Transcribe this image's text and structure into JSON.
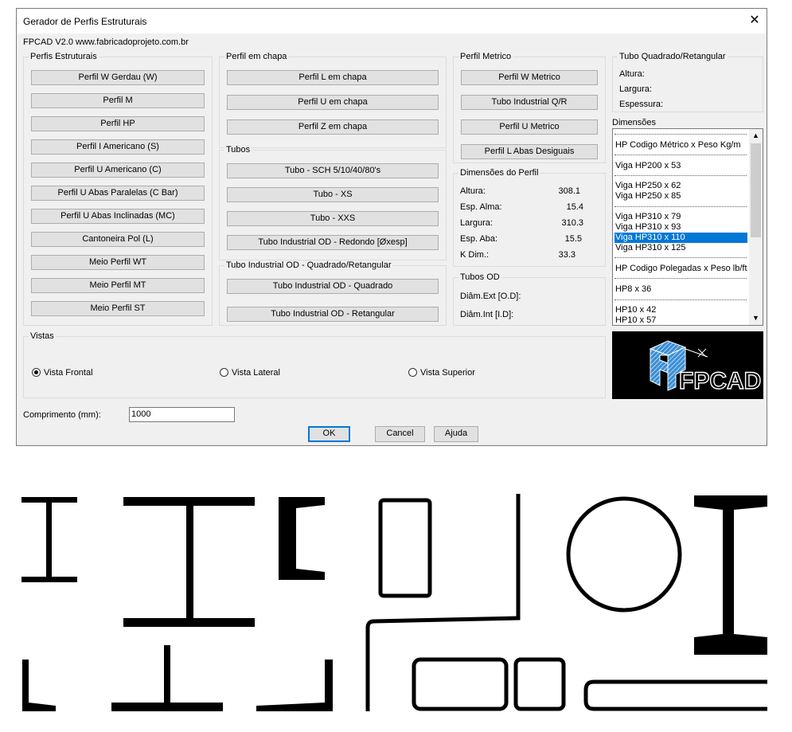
{
  "window": {
    "title": "Gerador de Perfis Estruturais",
    "close_glyph": "✕"
  },
  "header": {
    "version": "FPCAD V2.0 www.fabricadoprojeto.com.br"
  },
  "groups": {
    "perfis_estruturais": {
      "label": "Perfis Estruturais",
      "buttons": [
        "Perfil W Gerdau (W)",
        "Perfil M",
        "Perfil HP",
        "Perfil I Americano (S)",
        "Perfil U Americano (C)",
        "Perfil U Abas Paralelas (C Bar)",
        "Perfil U Abas Inclinadas (MC)",
        "Cantoneira Pol (L)",
        "Meio Perfil WT",
        "Meio Perfil MT",
        "Meio Perfil ST"
      ]
    },
    "perfil_chapa": {
      "label": "Perfil em chapa",
      "buttons": [
        "Perfil L em chapa",
        "Perfil U em chapa",
        "Perfil Z em chapa"
      ]
    },
    "tubos": {
      "label": "Tubos",
      "buttons": [
        "Tubo - SCH 5/10/40/80's",
        "Tubo - XS",
        "Tubo - XXS",
        "Tubo Industrial OD - Redondo [Øxesp]"
      ]
    },
    "tubo_quad": {
      "label": "Tubo Industrial OD - Quadrado/Retangular",
      "buttons": [
        "Tubo Industrial OD - Quadrado",
        "Tubo Industrial OD - Retangular"
      ]
    },
    "perfil_metrico": {
      "label": "Perfil Metrico",
      "buttons": [
        "Perfil W Metrico",
        "Tubo Industrial Q/R",
        "Perfil U Metrico",
        "Perfil L Abas Desiguais"
      ]
    },
    "dimensoes_perfil": {
      "label": "Dimensões do Perfil",
      "rows": [
        {
          "label": "Altura:",
          "value": "308.1"
        },
        {
          "label": "Esp. Alma:",
          "value": "15.4"
        },
        {
          "label": "Largura:",
          "value": "310.3"
        },
        {
          "label": "Esp. Aba:",
          "value": "15.5"
        },
        {
          "label": "K Dim.:",
          "value": "33.3"
        }
      ]
    },
    "tubos_od": {
      "label": "Tubos OD",
      "rows": [
        "Diâm.Ext [O.D]:",
        "Diâm.Int [I.D]:"
      ]
    },
    "tubo_quad_ret": {
      "label": "Tubo Quadrado/Retangular",
      "rows": [
        "Altura:",
        "Largura:",
        "Espessura:"
      ]
    },
    "dimensoes": {
      "label": "Dimensões",
      "items": [
        "HP Codigo Métrico x Peso Kg/m",
        "Viga HP200 x 53",
        "Viga HP250 x 62",
        "Viga HP250 x 85",
        "Viga HP310 x 79",
        "Viga HP310 x 93",
        "Viga HP310 x 110",
        "Viga HP310 x 125",
        "HP Codigo Polegadas x Peso lb/ft",
        "HP8 x 36",
        "HP10 x 42",
        "HP10 x 57"
      ],
      "selected": "Viga HP310 x 110"
    },
    "vistas": {
      "label": "Vistas",
      "options": [
        "Vista Frontal",
        "Vista Lateral",
        "Vista Superior"
      ],
      "selected": "Vista Frontal"
    }
  },
  "comprimento": {
    "label": "Comprimento (mm):",
    "value": "1000"
  },
  "actions": {
    "ok": "OK",
    "cancel": "Cancel",
    "help": "Ajuda"
  },
  "logo": {
    "text": "FPCAD"
  },
  "colors": {
    "accent": "#0078d7",
    "dialog_bg": "#f0f0f0",
    "logo_bg": "#000000",
    "logo_blue": "#3a8fd6"
  }
}
